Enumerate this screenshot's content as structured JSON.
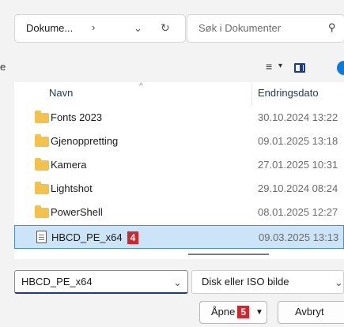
{
  "address_bar": {
    "path": "Dokume...",
    "separator": "›",
    "dropdown": "⌄",
    "refresh": "↻"
  },
  "search": {
    "placeholder": "Søk i Dokumenter",
    "icon": "⚲"
  },
  "toolbar": {
    "left_letter": "e",
    "view_icon": "≡",
    "view_dropdown": "▾"
  },
  "columns": {
    "name": "Navn",
    "date": "Endringsdato",
    "sort_caret": "^"
  },
  "rows": [
    {
      "name": "Fonts 2023",
      "date": "30.10.2024 13:22",
      "type": "folder"
    },
    {
      "name": "Gjenoppretting",
      "date": "09.01.2025 13:18",
      "type": "folder"
    },
    {
      "name": "Kamera",
      "date": "27.01.2025 10:31",
      "type": "folder"
    },
    {
      "name": "Lightshot",
      "date": "29.10.2024 08:24",
      "type": "folder"
    },
    {
      "name": "PowerShell",
      "date": "08.01.2025 12:27",
      "type": "folder"
    },
    {
      "name": "HBCD_PE_x64",
      "date": "09.03.2025 13:13",
      "type": "file",
      "selected": true,
      "badge": "4"
    }
  ],
  "filename": {
    "value": "HBCD_PE_x64",
    "dropdown": "⌄"
  },
  "filetype": {
    "value": "Disk eller ISO bilde",
    "dropdown": "⌄"
  },
  "buttons": {
    "open": "Åpne",
    "open_badge": "5",
    "open_split": "▼",
    "cancel": "Avbryt"
  },
  "colors": {
    "selection": "#cce4f7",
    "badge": "#d0262d",
    "folder": "#f2c24c",
    "accent": "#1e3a8a"
  }
}
